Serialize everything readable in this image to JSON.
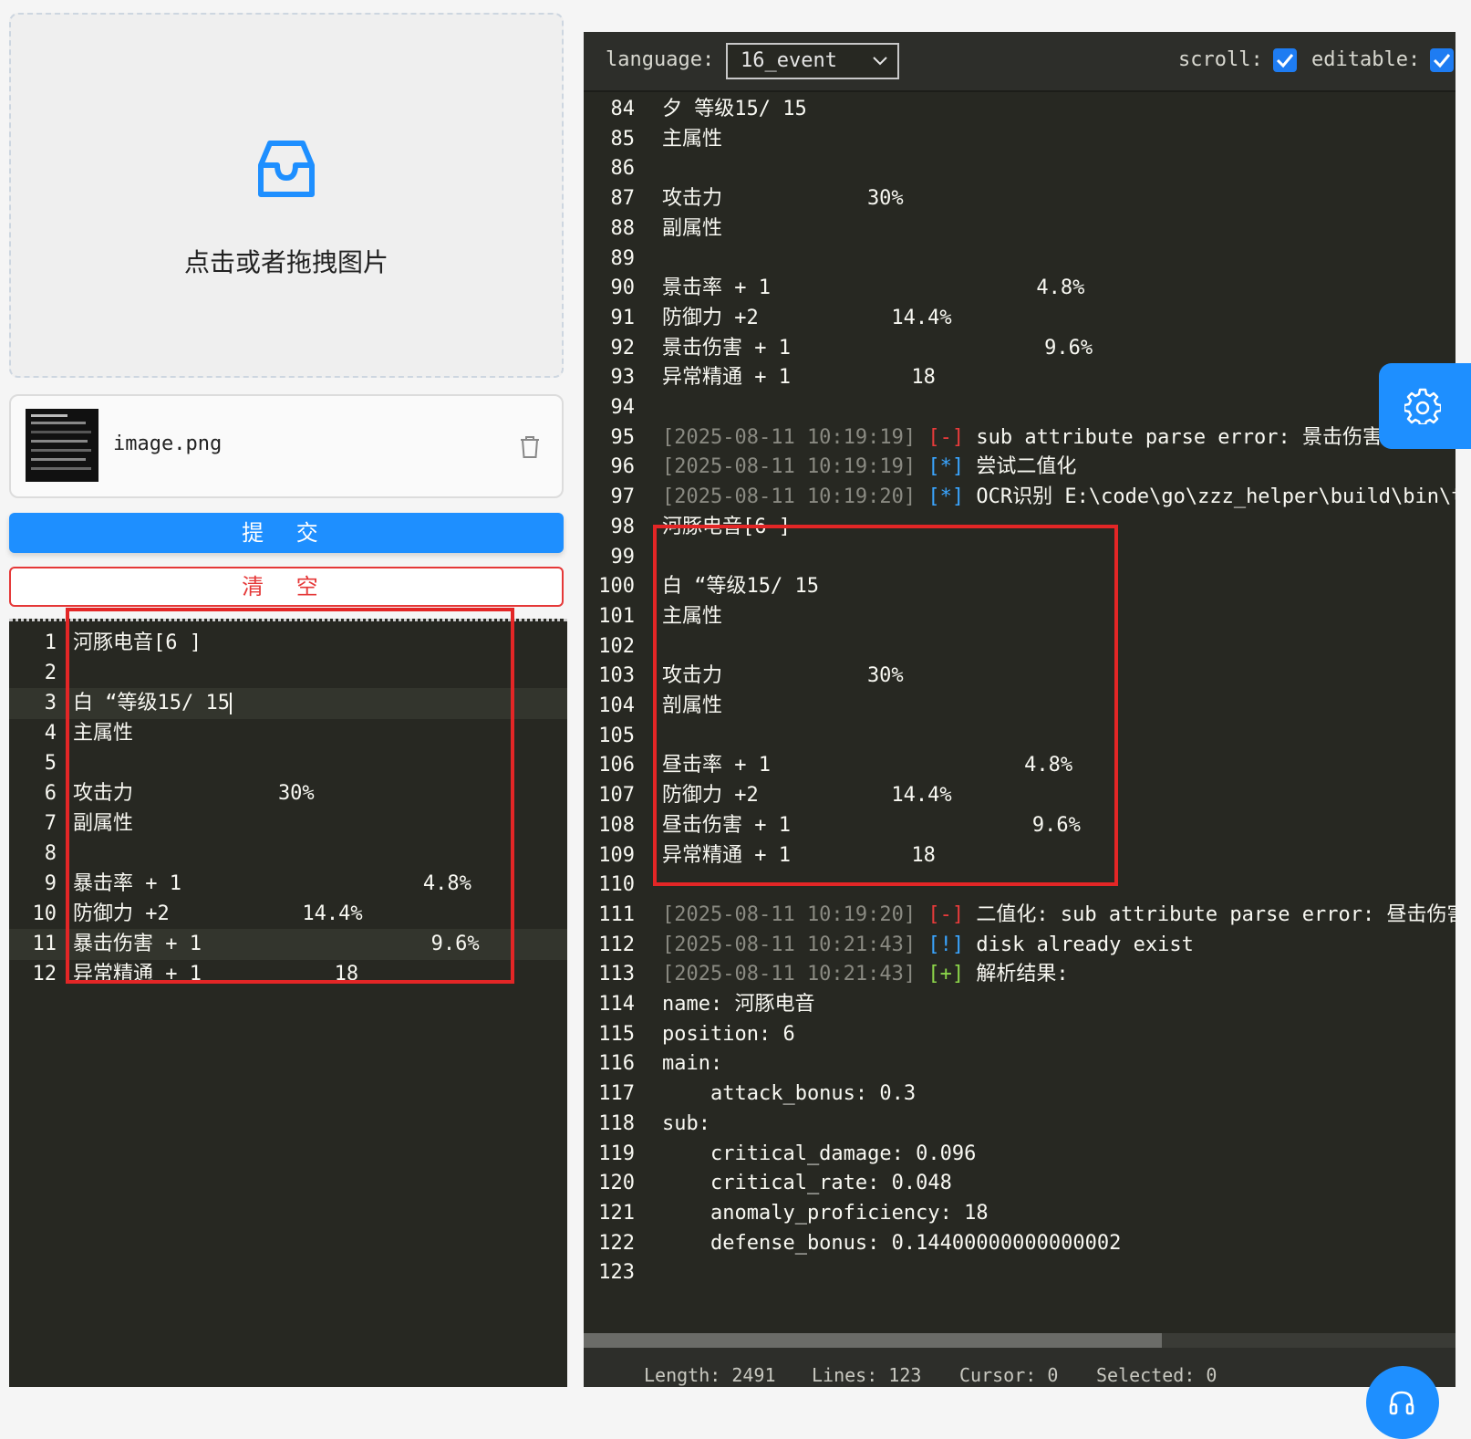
{
  "upload": {
    "hint": "点击或者拖拽图片",
    "file_name": "image.png",
    "submit_label": "提 交",
    "clear_label": "清 空"
  },
  "left_editor": {
    "lines": [
      {
        "n": "1",
        "text": "河豚电音[6 ]"
      },
      {
        "n": "2",
        "text": ""
      },
      {
        "n": "3",
        "text": "白 “等级15/ 15"
      },
      {
        "n": "4",
        "text": "主属性"
      },
      {
        "n": "5",
        "text": ""
      },
      {
        "n": "6",
        "text": "攻击力            30%"
      },
      {
        "n": "7",
        "text": "副属性"
      },
      {
        "n": "8",
        "text": ""
      },
      {
        "n": "9",
        "text": "暴击率 + 1                    4.8%"
      },
      {
        "n": "10",
        "text": "防御力 +2           14.4%"
      },
      {
        "n": "11",
        "text": "暴击伤害 + 1                   9.6%"
      },
      {
        "n": "12",
        "text": "异常精通 + 1           18"
      }
    ]
  },
  "toolbar": {
    "language_label": "language:",
    "language_value": "16_event",
    "scroll_label": "scroll:",
    "editable_label": "editable:",
    "scroll_checked": true,
    "editable_checked": true
  },
  "right_editor": {
    "lines": [
      {
        "n": "84",
        "text": "夕 等级15/ 15"
      },
      {
        "n": "85",
        "text": "主属性"
      },
      {
        "n": "86",
        "text": ""
      },
      {
        "n": "87",
        "text": "攻击力            30%"
      },
      {
        "n": "88",
        "text": "副属性"
      },
      {
        "n": "89",
        "text": ""
      },
      {
        "n": "90",
        "text": "景击率 + 1                      4.8%"
      },
      {
        "n": "91",
        "text": "防御力 +2           14.4%"
      },
      {
        "n": "92",
        "text": "景击伤害 + 1                     9.6%"
      },
      {
        "n": "93",
        "text": "异常精通 + 1          18"
      },
      {
        "n": "94",
        "text": ""
      },
      {
        "n": "95",
        "ts": "[2025-08-11 10:19:19]",
        "mk": "[-]",
        "mkc": "r",
        "text": "sub attribute parse error: 景击伤害"
      },
      {
        "n": "96",
        "ts": "[2025-08-11 10:19:19]",
        "mk": "[*]",
        "mkc": "b",
        "text": "尝试二值化"
      },
      {
        "n": "97",
        "ts": "[2025-08-11 10:19:20]",
        "mk": "[*]",
        "mkc": "b",
        "text": "OCR识别 E:\\code\\go\\zzz_helper\\build\\bin\\t"
      },
      {
        "n": "98",
        "text": "河豚电音[6 ]"
      },
      {
        "n": "99",
        "text": ""
      },
      {
        "n": "100",
        "text": "白 “等级15/ 15"
      },
      {
        "n": "101",
        "text": "主属性"
      },
      {
        "n": "102",
        "text": ""
      },
      {
        "n": "103",
        "text": "攻击力            30%"
      },
      {
        "n": "104",
        "text": "剖属性"
      },
      {
        "n": "105",
        "text": ""
      },
      {
        "n": "106",
        "text": "昼击率 + 1                     4.8%"
      },
      {
        "n": "107",
        "text": "防御力 +2           14.4%"
      },
      {
        "n": "108",
        "text": "昼击伤害 + 1                    9.6%"
      },
      {
        "n": "109",
        "text": "异常精通 + 1          18"
      },
      {
        "n": "110",
        "text": ""
      },
      {
        "n": "111",
        "ts": "[2025-08-11 10:19:20]",
        "mk": "[-]",
        "mkc": "r",
        "text": "二值化: sub attribute parse error: 昼击伤害"
      },
      {
        "n": "112",
        "ts": "[2025-08-11 10:21:43]",
        "mk": "[!]",
        "mkc": "b",
        "text": "disk already exist"
      },
      {
        "n": "113",
        "ts": "[2025-08-11 10:21:43]",
        "mk": "[+]",
        "mkc": "g",
        "text": "解析结果:"
      },
      {
        "n": "114",
        "text": "name: 河豚电音"
      },
      {
        "n": "115",
        "text": "position: 6"
      },
      {
        "n": "116",
        "text": "main:"
      },
      {
        "n": "117",
        "text": "    attack_bonus: 0.3"
      },
      {
        "n": "118",
        "text": "sub:"
      },
      {
        "n": "119",
        "text": "    critical_damage: 0.096"
      },
      {
        "n": "120",
        "text": "    critical_rate: 0.048"
      },
      {
        "n": "121",
        "text": "    anomaly_proficiency: 18"
      },
      {
        "n": "122",
        "text": "    defense_bonus: 0.14400000000000002"
      },
      {
        "n": "123",
        "text": ""
      }
    ]
  },
  "status": {
    "length": "Length: 2491",
    "lines": "Lines: 123",
    "cursor": "Cursor: 0",
    "selected": "Selected: 0"
  },
  "icons": {
    "upload": "inbox-icon",
    "delete": "trash-icon",
    "settings": "gear-icon",
    "support": "headset-icon",
    "dropdown": "chevron-down-icon"
  },
  "colors": {
    "accent": "#1e8fff",
    "danger": "#e53838",
    "editor_bg": "#272822",
    "highlight_box": "#e32626"
  }
}
